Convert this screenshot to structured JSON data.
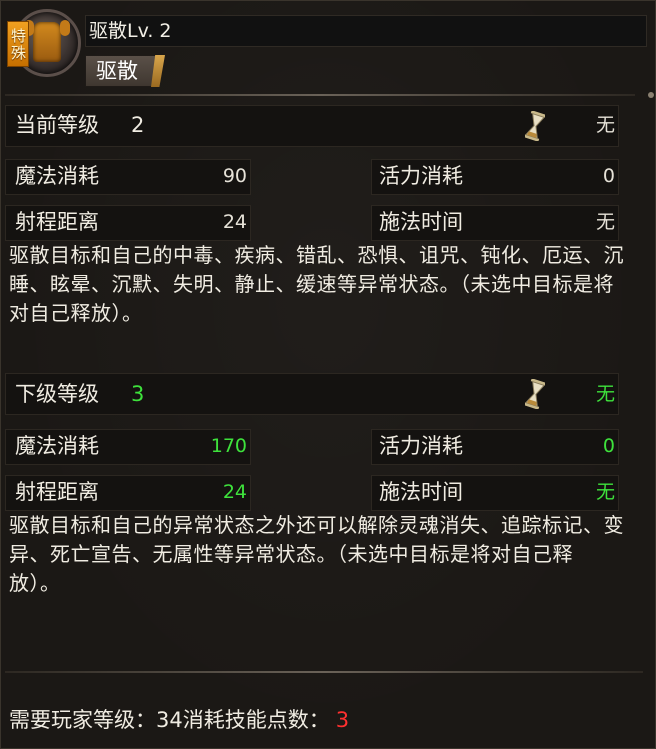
{
  "skill": {
    "tag": "特殊",
    "title": "驱散Lv. 2",
    "subtag": "驱散",
    "icon": "armor-icon"
  },
  "current": {
    "level_label": "当前等级",
    "level_value": "2",
    "cooldown_value": "无",
    "mana_label": "魔法消耗",
    "mana_value": "90",
    "vigor_label": "活力消耗",
    "vigor_value": "0",
    "range_label": "射程距离",
    "range_value": "24",
    "cast_label": "施法时间",
    "cast_value": "无",
    "description": "驱散目标和自己的中毒、疾病、错乱、恐惧、诅咒、钝化、厄运、沉睡、眩晕、沉默、失明、静止、缓速等异常状态。（未选中目标是将对自己释放）。"
  },
  "next": {
    "level_label": "下级等级",
    "level_value": "3",
    "cooldown_value": "无",
    "mana_label": "魔法消耗",
    "mana_value": "170",
    "vigor_label": "活力消耗",
    "vigor_value": "0",
    "range_label": "射程距离",
    "range_value": "24",
    "cast_label": "施法时间",
    "cast_value": "无",
    "description": "驱散目标和自己的异常状态之外还可以解除灵魂消失、追踪标记、变异、死亡宣告、无属性等异常状态。（未选中目标是将对自己释放）。"
  },
  "footer": {
    "req_label": "需要玩家等级：",
    "req_value": "34",
    "cost_label": "消耗技能点数：",
    "cost_value": "3"
  },
  "colors": {
    "upgrade": "#3ee23c",
    "cost": "#ff3030"
  }
}
